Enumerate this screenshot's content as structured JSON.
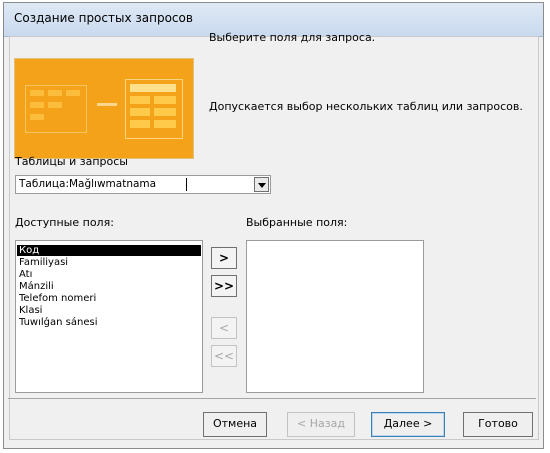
{
  "window": {
    "title": "Создание простых запросов"
  },
  "help": {
    "line1": "Выберите поля для запроса.",
    "line2": "Допускается выбор нескольких таблиц или запросов."
  },
  "tables": {
    "label": "Таблицы и запросы",
    "selected": "Таблица:Mağlıwmatnama"
  },
  "available": {
    "label": "Доступные поля:",
    "items": [
      "Код",
      "Familiyasi",
      "Atı",
      "Mánzili",
      "Telefom nomeri",
      "Klasi",
      "Tuwılǵan sánesi"
    ],
    "selected_index": 0
  },
  "chosen": {
    "label": "Выбранные поля:",
    "items": []
  },
  "move_buttons": {
    "add_one": ">",
    "add_all": ">>",
    "remove_one": "<",
    "remove_all": "<<"
  },
  "footer": {
    "cancel": "Отмена",
    "back": "< Назад",
    "next": "Далее >",
    "finish": "Готово"
  },
  "colors": {
    "banner": "#f4a21a",
    "selection": "#000000"
  }
}
